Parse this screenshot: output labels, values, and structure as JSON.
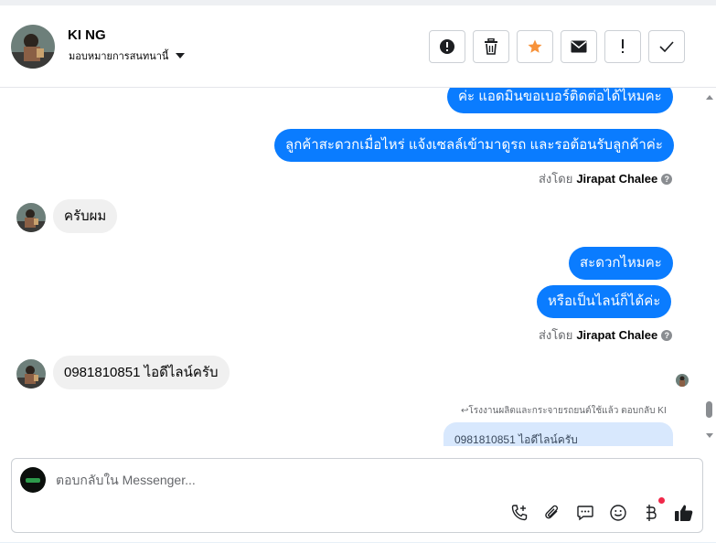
{
  "header": {
    "contact_name": "KI NG",
    "assign_label": "มอบหมายการสนทนานี้",
    "toolbar": [
      {
        "icon": "alert-circle-icon"
      },
      {
        "icon": "trash-icon"
      },
      {
        "icon": "star-icon"
      },
      {
        "icon": "envelope-icon"
      },
      {
        "icon": "exclamation-icon"
      },
      {
        "icon": "checkmark-icon"
      }
    ]
  },
  "messages": {
    "out1": "ค่ะ แอดมินขอเบอร์ติดต่อได้ไหมคะ",
    "out2": "ลูกค้าสะดวกเมื่อไหร่ แจ้งเซลล์เข้ามาดูรถ และรอต้อนรับลูกค้าค่ะ",
    "sent_by_prefix": "ส่งโดย",
    "agent_name": "Jirapat Chalee",
    "in1": "ครับผม",
    "out3": "สะดวกไหมคะ",
    "out4": "หรือเป็นไลน์ก็ได้ค่ะ",
    "in2": "0981810851 ไอดีไลน์ครับ",
    "reply_note": "↩โรงงานผลิตและกระจายรถยนต์ใช้แล้ว ตอบกลับ KI",
    "quoted_text": "0981810851 ไอดีไลน์ครับ"
  },
  "composer": {
    "placeholder": "ตอบกลับใน Messenger..."
  },
  "colors": {
    "accent": "#0a7cff",
    "star": "#f7923a",
    "notification": "#f02849"
  }
}
